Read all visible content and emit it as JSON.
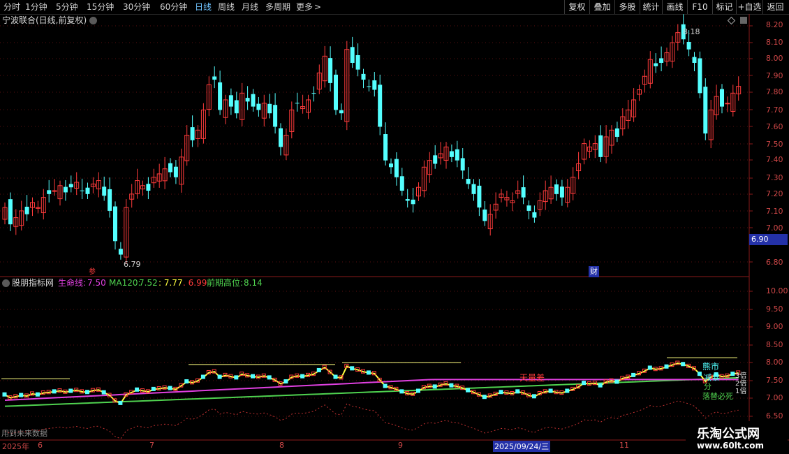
{
  "toolbar": {
    "periods": [
      "分时",
      "1分钟",
      "5分钟",
      "15分钟",
      "30分钟",
      "60分钟",
      "日线",
      "周线",
      "月线",
      "多周期",
      "更多"
    ],
    "active_period": "日线",
    "more_arrow": ">",
    "buttons": [
      "复权",
      "叠加",
      "多股",
      "统计",
      "画线",
      "F10",
      "标记",
      "+自选",
      "返回"
    ]
  },
  "main_chart": {
    "title": "宁波联合(日线,前复权)",
    "price_axis": [
      "8.20",
      "8.10",
      "8.00",
      "7.90",
      "7.80",
      "7.70",
      "7.60",
      "7.50",
      "7.40",
      "7.30",
      "7.20",
      "7.10",
      "7.00",
      "6.80"
    ],
    "current_price": "6.90",
    "high_label": "8.18",
    "low_label": "6.79",
    "marker_left": "参",
    "marker_cai": "财"
  },
  "indicator": {
    "name": "股朋指标网",
    "life_line_label": "生命线:",
    "life_line_value": "7.50",
    "ma120_label": "MA120:",
    "ma120_value": "7.52",
    "value3": ": 7.77",
    "value4": ". 6.99",
    "prev_high_label": "前期高位:",
    "prev_high_value": "8.14",
    "axis": [
      "10.00",
      "9.50",
      "9.00",
      "8.50",
      "8.00",
      "7.50",
      "7.00",
      "6.50"
    ],
    "annotations": {
      "tianli": "天量差",
      "shi": "熊市",
      "jian": "减",
      "hu": "暴",
      "fen": "分",
      "tibi": "落替必死"
    },
    "multi_labels": [
      "3倍",
      "2倍",
      "1倍"
    ],
    "future_data": "用到未来数据"
  },
  "dates": {
    "year": "2025年",
    "months": [
      "6",
      "7",
      "8",
      "9",
      "11"
    ],
    "cursor_date": "2025/09/24/三"
  },
  "watermark": {
    "site": "乐淘公式网",
    "url": "www.60lt.com"
  },
  "colors": {
    "up": "#ff3b3b",
    "down": "#54ffff",
    "life": "#e040e0",
    "ma120": "#4fd24f",
    "yellow": "#ffff40"
  }
}
